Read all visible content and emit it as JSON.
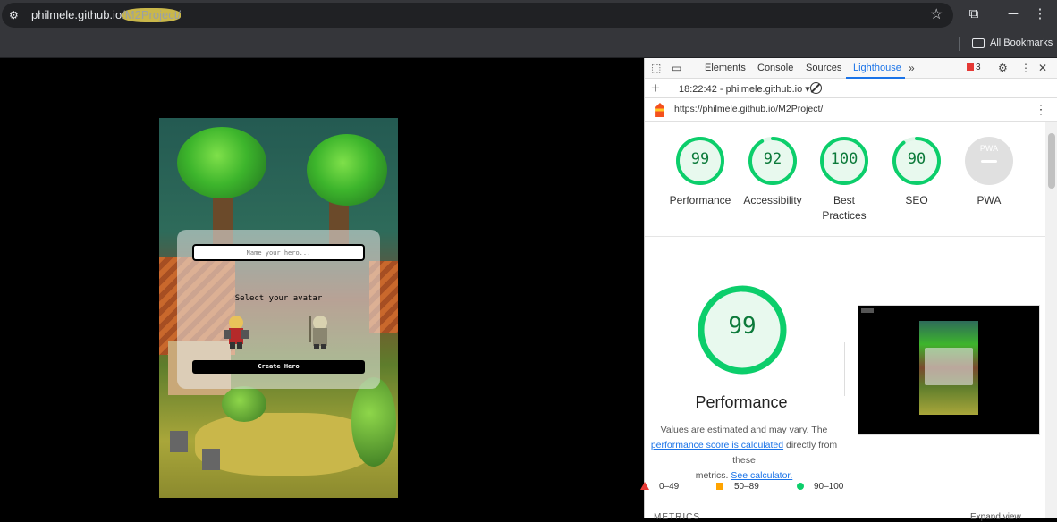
{
  "browser": {
    "url_host": "philmele.github.io",
    "url_path": "/M2Project/",
    "bookmarks_label": "All Bookmarks"
  },
  "game": {
    "name_placeholder": "Name your hero...",
    "select_label": "Select your avatar",
    "create_button": "Create Hero"
  },
  "devtools": {
    "tabs": [
      "Elements",
      "Console",
      "Sources",
      "Lighthouse"
    ],
    "active_tab": "Lighthouse",
    "issues_count": "3",
    "report_time": "18:22:42 - philmele.github.io",
    "report_url": "https://philmele.github.io/M2Project/"
  },
  "scores": [
    {
      "value": "99",
      "label": "Performance",
      "fraction": 0.99
    },
    {
      "value": "92",
      "label": "Accessibility",
      "fraction": 0.92
    },
    {
      "value": "100",
      "label": "Best Practices",
      "fraction": 1.0
    },
    {
      "value": "90",
      "label": "SEO",
      "fraction": 0.9
    },
    {
      "value": "PWA",
      "label": "PWA",
      "fraction": 0
    }
  ],
  "performance": {
    "score": "99",
    "fraction": 0.99,
    "title": "Performance",
    "desc_1": "Values are estimated and may vary. The",
    "desc_link": "performance score is calculated",
    "desc_2": "directly from these",
    "desc_3": "metrics.",
    "calc_link": "See calculator."
  },
  "legend": {
    "fail": "0–49",
    "average": "50–89",
    "pass": "90–100"
  },
  "metrics_label": "METRICS",
  "expand_label": "Expand view",
  "colors": {
    "pass": "#0cce6b",
    "pass_text": "#0c7a3a",
    "average": "#ffa400",
    "fail": "#e53935",
    "accent": "#1a73e8"
  }
}
